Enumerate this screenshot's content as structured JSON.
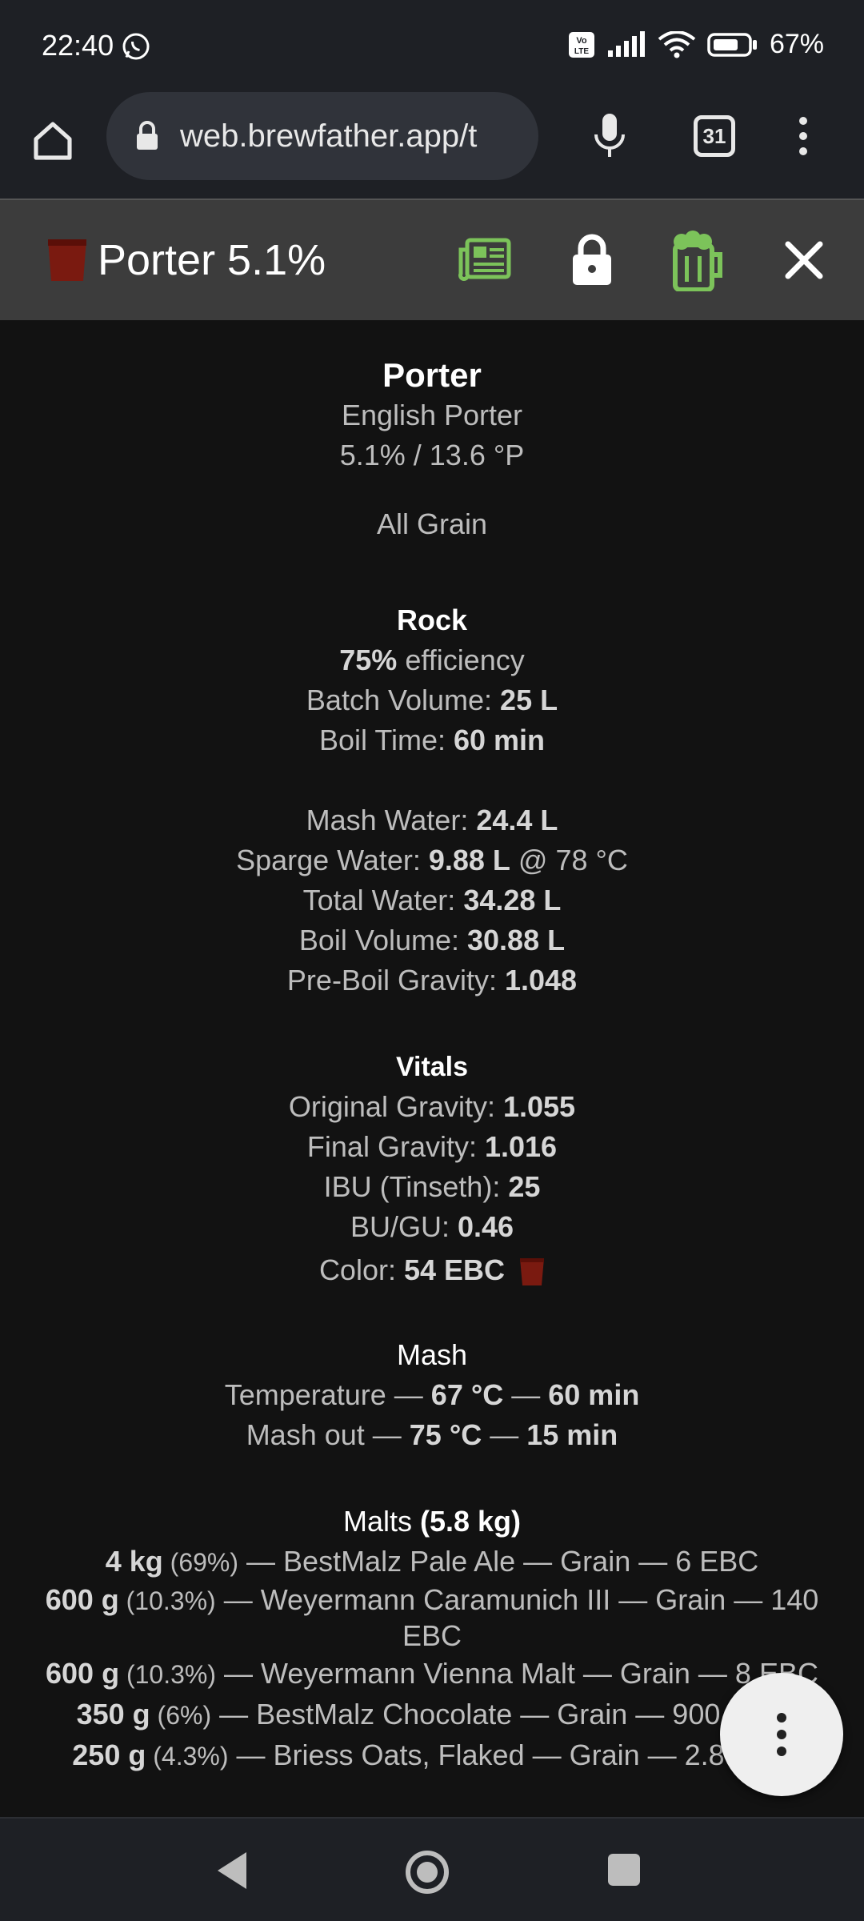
{
  "status": {
    "time": "22:40",
    "battery": "67%",
    "volte": "Vo LTE"
  },
  "browser": {
    "url": "web.brewfather.app/t",
    "tab_count": "31"
  },
  "header": {
    "title": "Porter 5.1%"
  },
  "recipe": {
    "name": "Porter",
    "style": "English Porter",
    "abv_og": "5.1% / 13.6 °P",
    "type": "All Grain"
  },
  "equipment": {
    "name": "Rock",
    "efficiency_value": "75%",
    "efficiency_label": " efficiency",
    "batch_label": "Batch Volume: ",
    "batch_value": "25 L",
    "boil_label": "Boil Time: ",
    "boil_value": "60 min"
  },
  "water": {
    "mash_label": "Mash Water: ",
    "mash_value": "24.4 L",
    "sparge_label": "Sparge Water: ",
    "sparge_value": "9.88 L",
    "sparge_temp": " @ 78 °C",
    "total_label": "Total Water: ",
    "total_value": "34.28 L",
    "boilvol_label": "Boil Volume: ",
    "boilvol_value": "30.88 L",
    "preboil_label": "Pre-Boil Gravity: ",
    "preboil_value": "1.048"
  },
  "vitals": {
    "title": "Vitals",
    "og_label": "Original Gravity: ",
    "og_value": "1.055",
    "fg_label": "Final Gravity: ",
    "fg_value": "1.016",
    "ibu_label": "IBU (Tinseth): ",
    "ibu_value": "25",
    "bugu_label": "BU/GU: ",
    "bugu_value": "0.46",
    "color_label": "Color: ",
    "color_value": "54 EBC",
    "color_hex": "#7a1a10"
  },
  "mash": {
    "title": "Mash",
    "steps": [
      {
        "name": "Temperature — ",
        "temp": "67 °C",
        "sep": " — ",
        "time": "60 min"
      },
      {
        "name": "Mash out — ",
        "temp": "75 °C",
        "sep": " — ",
        "time": "15 min"
      }
    ]
  },
  "malts": {
    "title": "Malts ",
    "total": "(5.8 kg)",
    "items": [
      {
        "amount": "4 kg",
        "pct": " (69%)",
        "desc": " — BestMalz Pale Ale — Grain — 6 EBC"
      },
      {
        "amount": "600 g",
        "pct": " (10.3%)",
        "desc": " — Weyermann Caramunich III — Grain — 140 EBC"
      },
      {
        "amount": "600 g",
        "pct": " (10.3%)",
        "desc": " — Weyermann Vienna Malt — Grain — 8 EBC"
      },
      {
        "amount": "350 g",
        "pct": " (6%)",
        "desc": " — BestMalz Chocolate — Grain — 900 EBC"
      },
      {
        "amount": "250 g",
        "pct": " (4.3%)",
        "desc": " — Briess Oats, Flaked — Grain — 2.8 EBC"
      }
    ]
  }
}
